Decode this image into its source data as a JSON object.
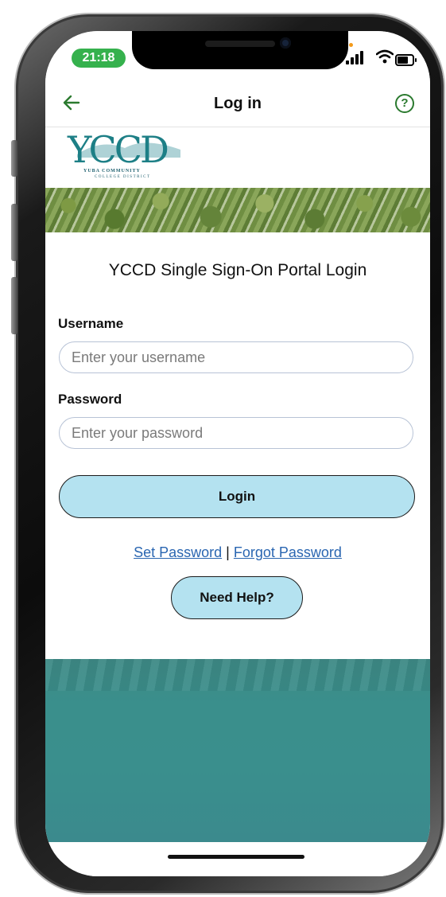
{
  "status_bar": {
    "time": "21:18"
  },
  "nav": {
    "title": "Log in",
    "help_glyph": "?"
  },
  "logo": {
    "wordmark": "YCCD",
    "line1": "YUBA COMMUNITY",
    "line2": "COLLEGE DISTRICT"
  },
  "form": {
    "heading": "YCCD Single Sign-On Portal Login",
    "username_label": "Username",
    "username_placeholder": "Enter your username",
    "password_label": "Password",
    "password_placeholder": "Enter your password",
    "login_button": "Login"
  },
  "links": {
    "set_password": "Set Password",
    "separator": "|",
    "forgot_password": "Forgot Password"
  },
  "help_button": "Need Help?",
  "colors": {
    "accent_green": "#2b7a2f",
    "button_fill": "#b4e2f0",
    "link_blue": "#2a66b1",
    "teal_background": "#3a8f8c",
    "time_pill": "#35b14d"
  }
}
